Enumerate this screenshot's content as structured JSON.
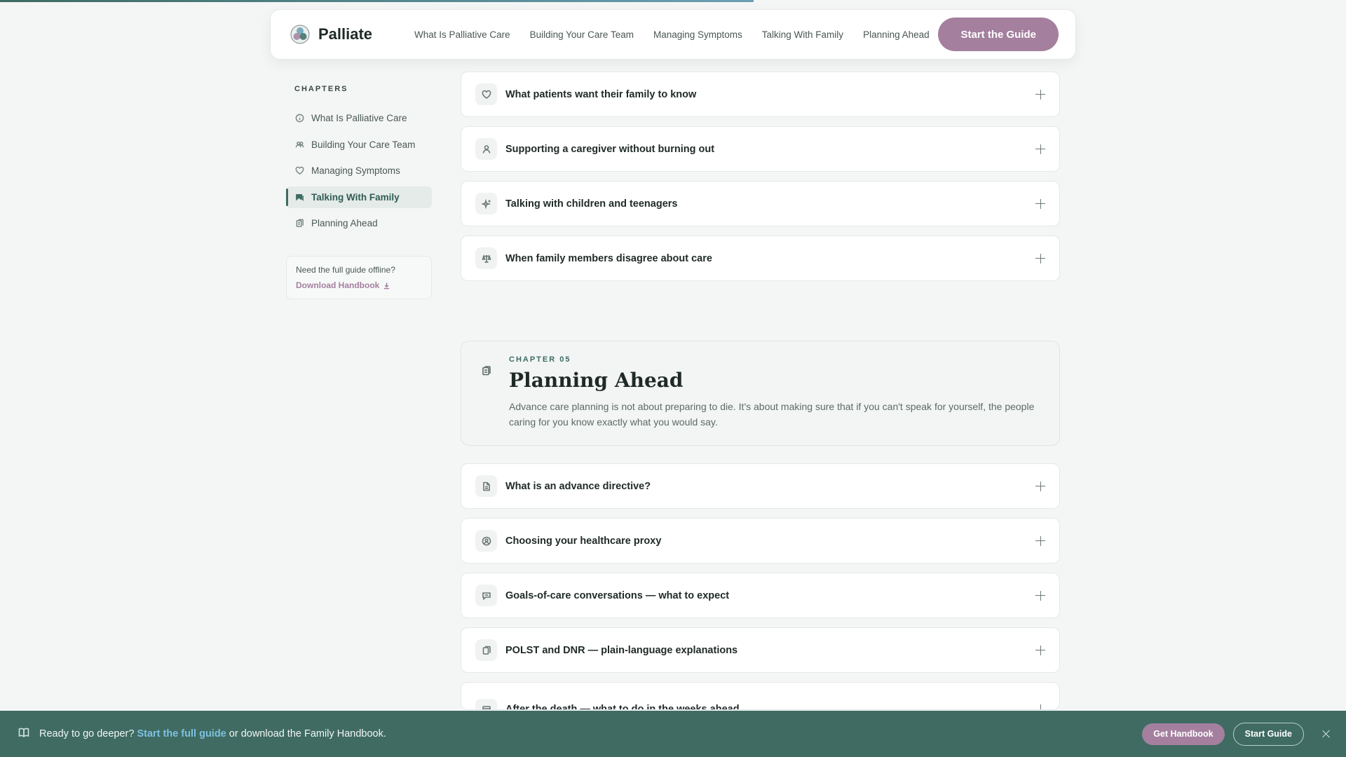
{
  "progress": {
    "fraction": 0.56
  },
  "header": {
    "brand": "Palliate",
    "nav": [
      "What Is Palliative Care",
      "Building Your Care Team",
      "Managing Symptoms",
      "Talking With Family",
      "Planning Ahead"
    ],
    "cta": "Start the Guide"
  },
  "sidebar": {
    "title": "CHAPTERS",
    "items": [
      {
        "label": "What Is Palliative Care",
        "icon": "info-icon"
      },
      {
        "label": "Building Your Care Team",
        "icon": "team-icon"
      },
      {
        "label": "Managing Symptoms",
        "icon": "heart-icon"
      },
      {
        "label": "Talking With Family",
        "icon": "chat-icon",
        "active": true
      },
      {
        "label": "Planning Ahead",
        "icon": "clipboard-icon"
      }
    ],
    "offline_text": "Need the full guide offline?",
    "offline_link": "Download Handbook"
  },
  "family_items": [
    {
      "title": "What patients want their family to know",
      "icon": "heart-icon"
    },
    {
      "title": "Supporting a caregiver without burning out",
      "icon": "user-icon"
    },
    {
      "title": "Talking with children and teenagers",
      "icon": "sparkle-icon"
    },
    {
      "title": "When family members disagree about care",
      "icon": "scale-icon"
    }
  ],
  "chapter": {
    "label": "CHAPTER 05",
    "title": "Planning Ahead",
    "description": "Advance care planning is not about preparing to die. It's about making sure that if you can't speak for yourself, the people caring for you know exactly what you would say."
  },
  "planning_items": [
    {
      "title": "What is an advance directive?",
      "icon": "document-icon"
    },
    {
      "title": "Choosing your healthcare proxy",
      "icon": "person-circle-icon"
    },
    {
      "title": "Goals-of-care conversations — what to expect",
      "icon": "chat-icon"
    },
    {
      "title": "POLST and DNR — plain-language explanations",
      "icon": "clipboard-icon"
    },
    {
      "title": "After the death — what to do in the weeks ahead",
      "icon": "calendar-icon"
    }
  ],
  "banner": {
    "text_before": "Ready to go deeper?",
    "link": "Start the full guide",
    "text_after": "or download the Family Handbook.",
    "btn_handbook": "Get Handbook",
    "btn_guide": "Start Guide"
  },
  "colors": {
    "primary": "#3d6b62",
    "accent": "#a47f9e",
    "banner": "#3f6b62",
    "link": "#7ec1e0"
  }
}
